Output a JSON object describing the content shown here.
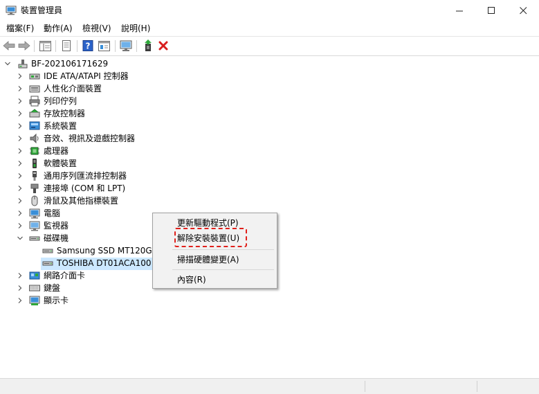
{
  "window": {
    "title": "裝置管理員",
    "controls": {
      "minimize": "—",
      "maximize": "☐",
      "close": "✕"
    }
  },
  "menubar": {
    "items": [
      {
        "label": "檔案(F)"
      },
      {
        "label": "動作(A)"
      },
      {
        "label": "檢視(V)"
      },
      {
        "label": "說明(H)"
      }
    ]
  },
  "toolbar": {
    "buttons": [
      "back-arrow-icon",
      "forward-arrow-icon",
      "properties-icon",
      "show-hide-icon",
      "help-icon",
      "view-icon",
      "monitor-scan-icon",
      "update-driver-icon",
      "uninstall-x-icon"
    ],
    "accent_red": "#e0201b",
    "accent_blue": "#2a62c9"
  },
  "tree": {
    "root": "BF-202106171629",
    "categories": [
      {
        "label": "IDE ATA/ATAPI 控制器",
        "icon": "ide-controller-icon"
      },
      {
        "label": "人性化介面裝置",
        "icon": "hid-icon"
      },
      {
        "label": "列印佇列",
        "icon": "print-queue-icon"
      },
      {
        "label": "存放控制器",
        "icon": "storage-controller-icon"
      },
      {
        "label": "系統裝置",
        "icon": "system-device-icon"
      },
      {
        "label": "音效、視訊及遊戲控制器",
        "icon": "audio-icon"
      },
      {
        "label": "處理器",
        "icon": "processor-icon"
      },
      {
        "label": "軟體裝置",
        "icon": "software-device-icon"
      },
      {
        "label": "通用序列匯流排控制器",
        "icon": "usb-controller-icon"
      },
      {
        "label": "連接埠 (COM 和 LPT)",
        "icon": "port-icon"
      },
      {
        "label": "滑鼠及其他指標裝置",
        "icon": "mouse-icon"
      },
      {
        "label": "電腦",
        "icon": "computer-icon"
      },
      {
        "label": "監視器",
        "icon": "monitor-icon"
      }
    ],
    "disk_category": {
      "label": "磁碟機",
      "icon": "disk-drive-icon"
    },
    "disk_children": [
      {
        "label": "Samsung SSD MT120G PRO ATA Device"
      },
      {
        "label": "TOSHIBA DT01ACA100 ATA Device"
      }
    ],
    "after_categories": [
      {
        "label": "網路介面卡",
        "icon": "network-adapter-icon"
      },
      {
        "label": "鍵盤",
        "icon": "keyboard-icon"
      },
      {
        "label": "顯示卡",
        "icon": "display-adapter-icon"
      }
    ],
    "selection_color": "#cce8ff"
  },
  "context_menu": {
    "items": [
      {
        "label": "更新驅動程式(P)"
      },
      {
        "label": "解除安裝裝置(U)"
      },
      {
        "label": "掃描硬體變更(A)"
      },
      {
        "label": "內容(R)"
      }
    ]
  }
}
